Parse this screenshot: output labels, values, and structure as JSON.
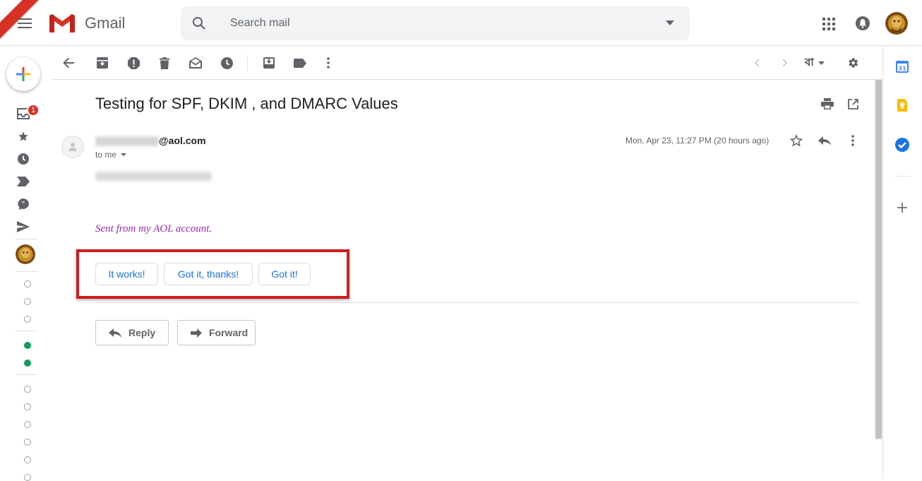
{
  "app": {
    "title": "Gmail"
  },
  "search": {
    "placeholder": "Search mail"
  },
  "rail": {
    "inbox_badge": "1"
  },
  "toolbar": {
    "language": "বা"
  },
  "message": {
    "subject": "Testing for SPF, DKIM , and DMARC Values",
    "sender_domain": "@aol.com",
    "to": "to me",
    "date": "Mon, Apr 23, 11:27 PM (20 hours ago)",
    "signature": "Sent from my AOL account."
  },
  "smart_replies": [
    "It works!",
    "Got it, thanks!",
    "Got it!"
  ],
  "actions": {
    "reply": "Reply",
    "forward": "Forward"
  },
  "side_panel": {
    "calendar_day": "31"
  },
  "colors": {
    "accent": "#1a73e8",
    "highlight": "#d01c1c",
    "signature": "#9c27b0",
    "badge": "#d93025"
  }
}
